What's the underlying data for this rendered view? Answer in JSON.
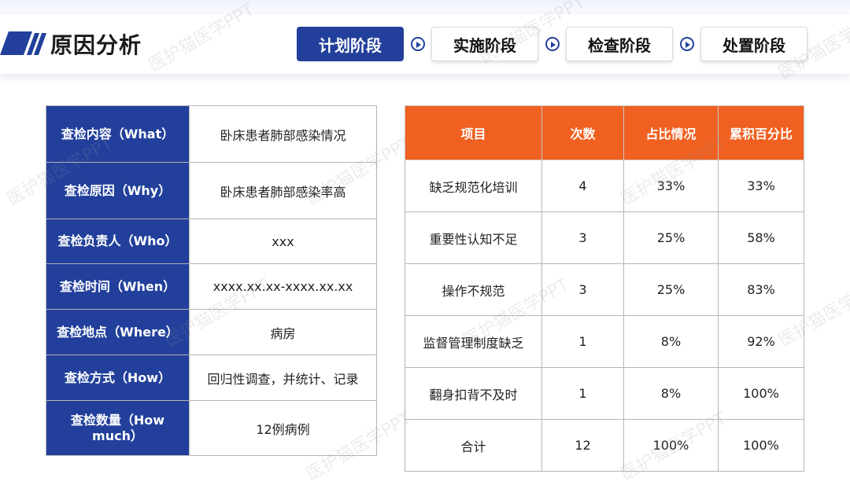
{
  "header": {
    "title": "原因分析",
    "steps": [
      "计划阶段",
      "实施阶段",
      "检查阶段",
      "处置阶段"
    ]
  },
  "left_table": [
    {
      "label": "查检内容（What）",
      "value": "卧床患者肺部感染情况"
    },
    {
      "label": "查检原因（Why）",
      "value": "卧床患者肺部感染率高"
    },
    {
      "label": "查检负责人（Who）",
      "value": "xxx"
    },
    {
      "label": "查检时间（When）",
      "value": "xxxx.xx.xx-xxxx.xx.xx"
    },
    {
      "label": "查检地点（Where）",
      "value": "病房"
    },
    {
      "label": "查检方式（How）",
      "value": "回归性调查，并统计、记录"
    },
    {
      "label": "查检数量（How much）",
      "value": "12例病例"
    }
  ],
  "right_table": {
    "headers": [
      "项目",
      "次数",
      "占比情况",
      "累积百分比"
    ],
    "rows": [
      [
        "缺乏规范化培训",
        "4",
        "33%",
        "33%"
      ],
      [
        "重要性认知不足",
        "3",
        "25%",
        "58%"
      ],
      [
        "操作不规范",
        "3",
        "25%",
        "83%"
      ],
      [
        "监督管理制度缺乏",
        "1",
        "8%",
        "92%"
      ],
      [
        "翻身扣背不及时",
        "1",
        "8%",
        "100%"
      ],
      [
        "合计",
        "12",
        "100%",
        "100%"
      ]
    ]
  },
  "watermark": "医护猫医学PPT",
  "colors": {
    "primary": "#22409b",
    "accent": "#f06020"
  }
}
